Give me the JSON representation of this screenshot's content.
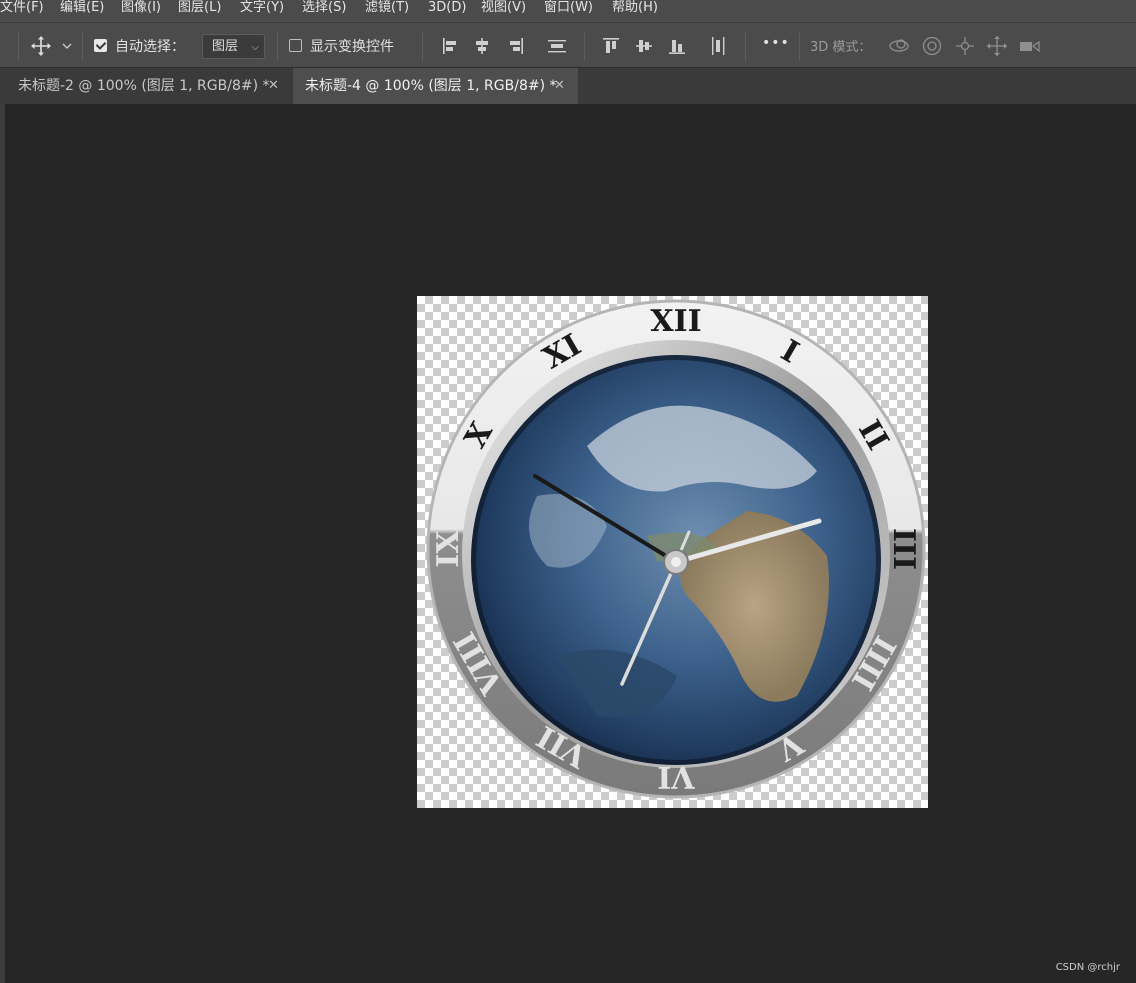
{
  "menu": {
    "items": [
      "文件(F)",
      "编辑(E)",
      "图像(I)",
      "图层(L)",
      "文字(Y)",
      "选择(S)",
      "滤镜(T)",
      "3D(D)",
      "视图(V)",
      "窗口(W)",
      "帮助(H)"
    ]
  },
  "options": {
    "auto_select_label": "自动选择：",
    "auto_select_checked": true,
    "layer_select_value": "图层",
    "show_transform_label": "显示变换控件",
    "show_transform_checked": false,
    "mode_3d_label": "3D 模式：",
    "more_label": "•••"
  },
  "tabs": [
    {
      "label": "未标题-2 @ 100% (图层 1, RGB/8#) *",
      "active": false
    },
    {
      "label": "未标题-4 @ 100% (图层 1, RGB/8#) *",
      "active": true
    }
  ],
  "clock": {
    "numerals": [
      "XII",
      "I",
      "II",
      "III",
      "IIII",
      "V",
      "VI",
      "VII",
      "VIII",
      "IX",
      "X",
      "XI"
    ],
    "hour_hand_direction_deg": 78,
    "minute_hand_direction_deg": 210,
    "second_hand_direction_deg": 300
  },
  "watermark": "CSDN @rchjr",
  "colors": {
    "menubar": "#4b4b4b",
    "workspace": "#262626",
    "tab_active": "#4e4e4e"
  }
}
